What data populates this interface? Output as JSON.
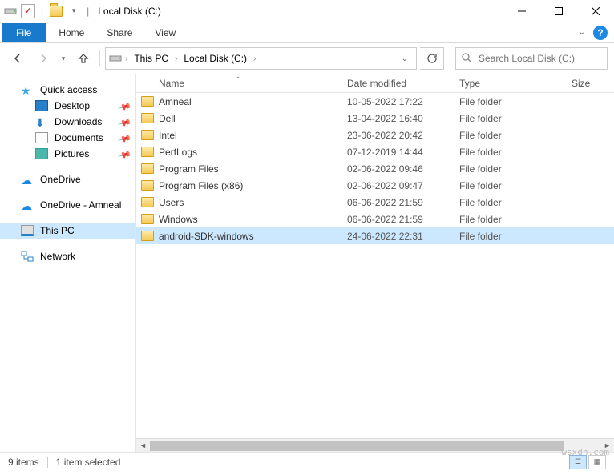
{
  "title": "Local Disk (C:)",
  "ribbon": {
    "file": "File",
    "tabs": [
      "Home",
      "Share",
      "View"
    ]
  },
  "breadcrumb": [
    "This PC",
    "Local Disk (C:)"
  ],
  "search_placeholder": "Search Local Disk (C:)",
  "columns": {
    "name": "Name",
    "date": "Date modified",
    "type": "Type",
    "size": "Size"
  },
  "navpane": {
    "quick_access": "Quick access",
    "quick_items": [
      {
        "label": "Desktop",
        "icon": "ic-desk"
      },
      {
        "label": "Downloads",
        "icon": "ic-dl"
      },
      {
        "label": "Documents",
        "icon": "ic-doc"
      },
      {
        "label": "Pictures",
        "icon": "ic-pic"
      }
    ],
    "onedrive": "OneDrive",
    "onedrive2": "OneDrive - Amneal",
    "thispc": "This PC",
    "network": "Network"
  },
  "files": [
    {
      "name": "Amneal",
      "date": "10-05-2022 17:22",
      "type": "File folder",
      "size": ""
    },
    {
      "name": "Dell",
      "date": "13-04-2022 16:40",
      "type": "File folder",
      "size": ""
    },
    {
      "name": "Intel",
      "date": "23-06-2022 20:42",
      "type": "File folder",
      "size": ""
    },
    {
      "name": "PerfLogs",
      "date": "07-12-2019 14:44",
      "type": "File folder",
      "size": ""
    },
    {
      "name": "Program Files",
      "date": "02-06-2022 09:46",
      "type": "File folder",
      "size": ""
    },
    {
      "name": "Program Files (x86)",
      "date": "02-06-2022 09:47",
      "type": "File folder",
      "size": ""
    },
    {
      "name": "Users",
      "date": "06-06-2022 21:59",
      "type": "File folder",
      "size": ""
    },
    {
      "name": "Windows",
      "date": "06-06-2022 21:59",
      "type": "File folder",
      "size": ""
    },
    {
      "name": "android-SDK-windows",
      "date": "24-06-2022 22:31",
      "type": "File folder",
      "size": "",
      "selected": true
    }
  ],
  "status": {
    "count": "9 items",
    "selected": "1 item selected"
  },
  "watermark": "wsxdn.com"
}
